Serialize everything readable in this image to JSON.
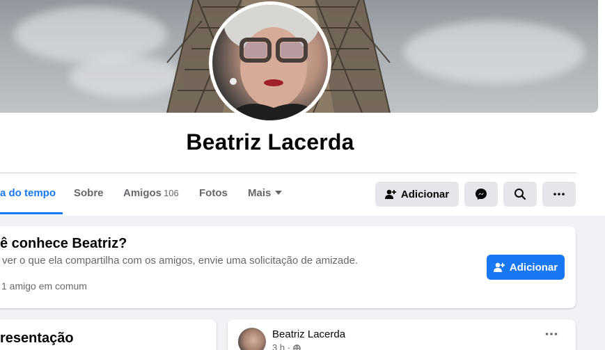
{
  "profile": {
    "name": "Beatriz Lacerda"
  },
  "tabs": [
    {
      "label": "a do tempo",
      "active": true
    },
    {
      "label": "Sobre"
    },
    {
      "label": "Amigos",
      "count": "106"
    },
    {
      "label": "Fotos"
    },
    {
      "label": "Mais"
    }
  ],
  "actions": {
    "add_friend_label": "Adicionar"
  },
  "suggest_card": {
    "title": "ê conhece Beatriz?",
    "subtitle": "ver o que ela compartilha com os amigos, envie uma solicitação de amizade.",
    "mutual": "1 amigo em comum",
    "button_label": "Adicionar"
  },
  "intro_card": {
    "title": "resentação"
  },
  "post": {
    "author": "Beatriz Lacerda",
    "time": "3 h ·"
  },
  "colors": {
    "accent": "#1877f2",
    "secondary_button": "#e4e6eb",
    "page_bg": "#f0f2f5"
  },
  "icons": {
    "add_friend": "person-plus-icon",
    "messenger": "messenger-icon",
    "search": "search-icon",
    "more": "more-dots-icon",
    "globe": "globe-icon"
  }
}
